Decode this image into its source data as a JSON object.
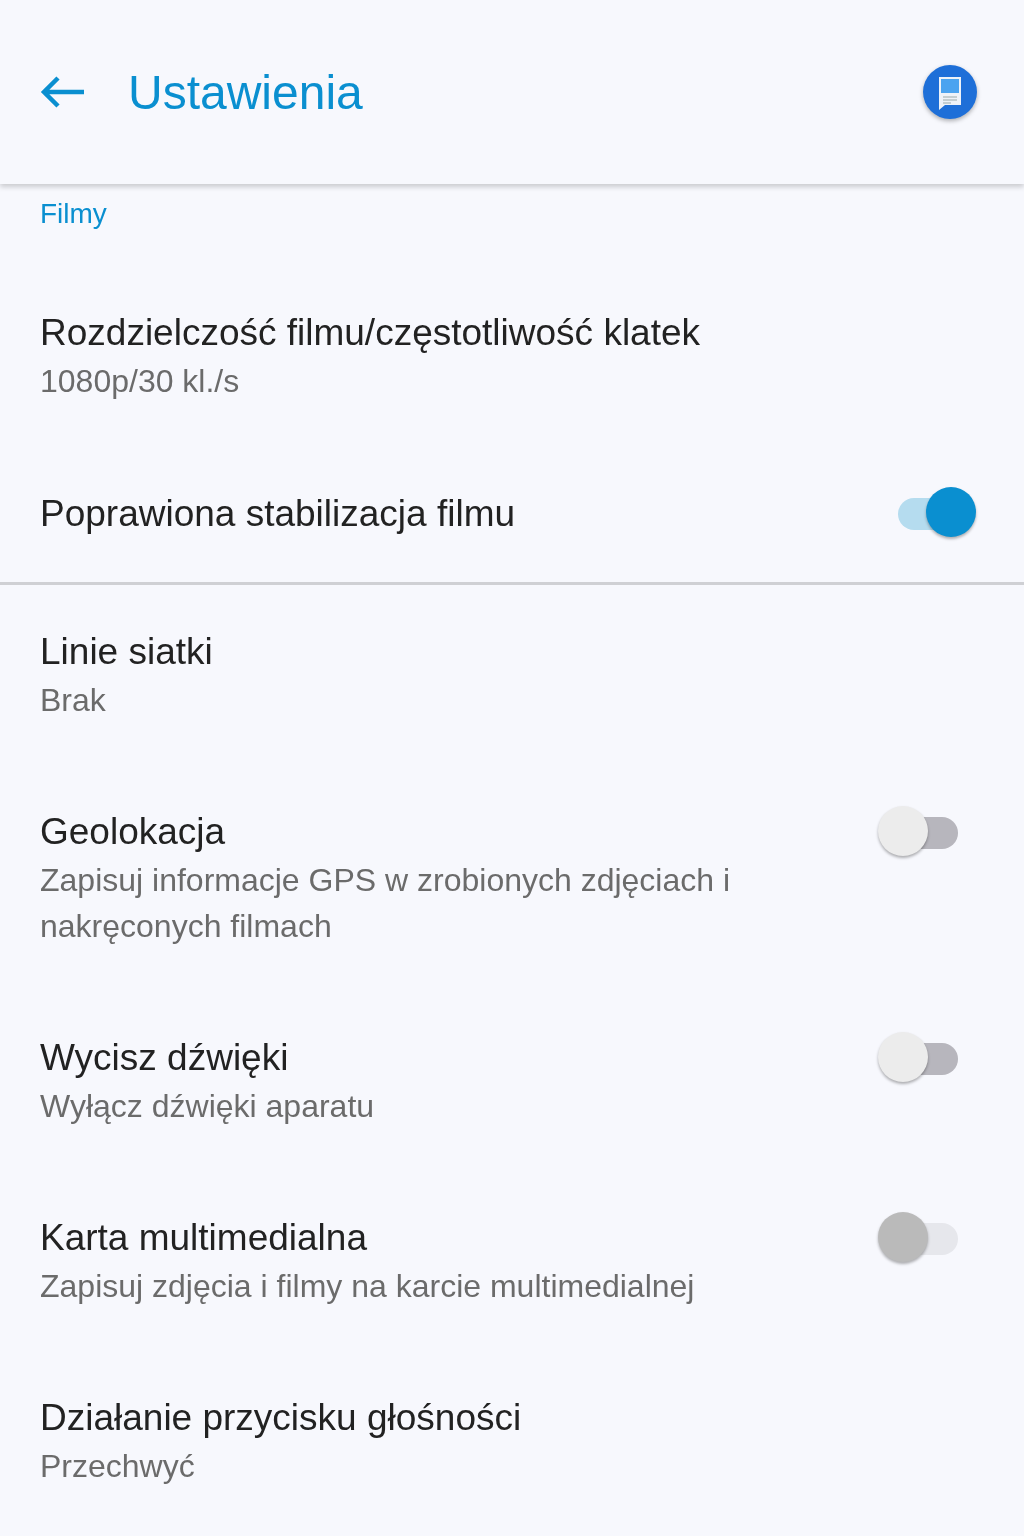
{
  "app_bar": {
    "title": "Ustawienia"
  },
  "section": {
    "title": "Filmy"
  },
  "items": [
    {
      "kind": "value",
      "title": "Rozdzielczość filmu/częstotliwość klatek",
      "summary": "1080p/30 kl./s"
    },
    {
      "kind": "switch",
      "title": "Poprawiona stabilizacja filmu",
      "on": true,
      "disabled": false,
      "divider_after": true
    },
    {
      "kind": "value",
      "title": "Linie siatki",
      "summary": "Brak"
    },
    {
      "kind": "switch",
      "title": "Geolokacja",
      "summary": "Zapisuj informacje GPS w zrobionych zdjęciach i nakręconych filmach",
      "on": false,
      "disabled": false
    },
    {
      "kind": "switch",
      "title": "Wycisz dźwięki",
      "summary": "Wyłącz dźwięki aparatu",
      "on": false,
      "disabled": false
    },
    {
      "kind": "switch",
      "title": "Karta multimedialna",
      "summary": "Zapisuj zdjęcia i filmy na karcie multimedialnej",
      "on": false,
      "disabled": true
    },
    {
      "kind": "value",
      "title": "Działanie przycisku głośności",
      "summary": "Przechwyć"
    }
  ]
}
